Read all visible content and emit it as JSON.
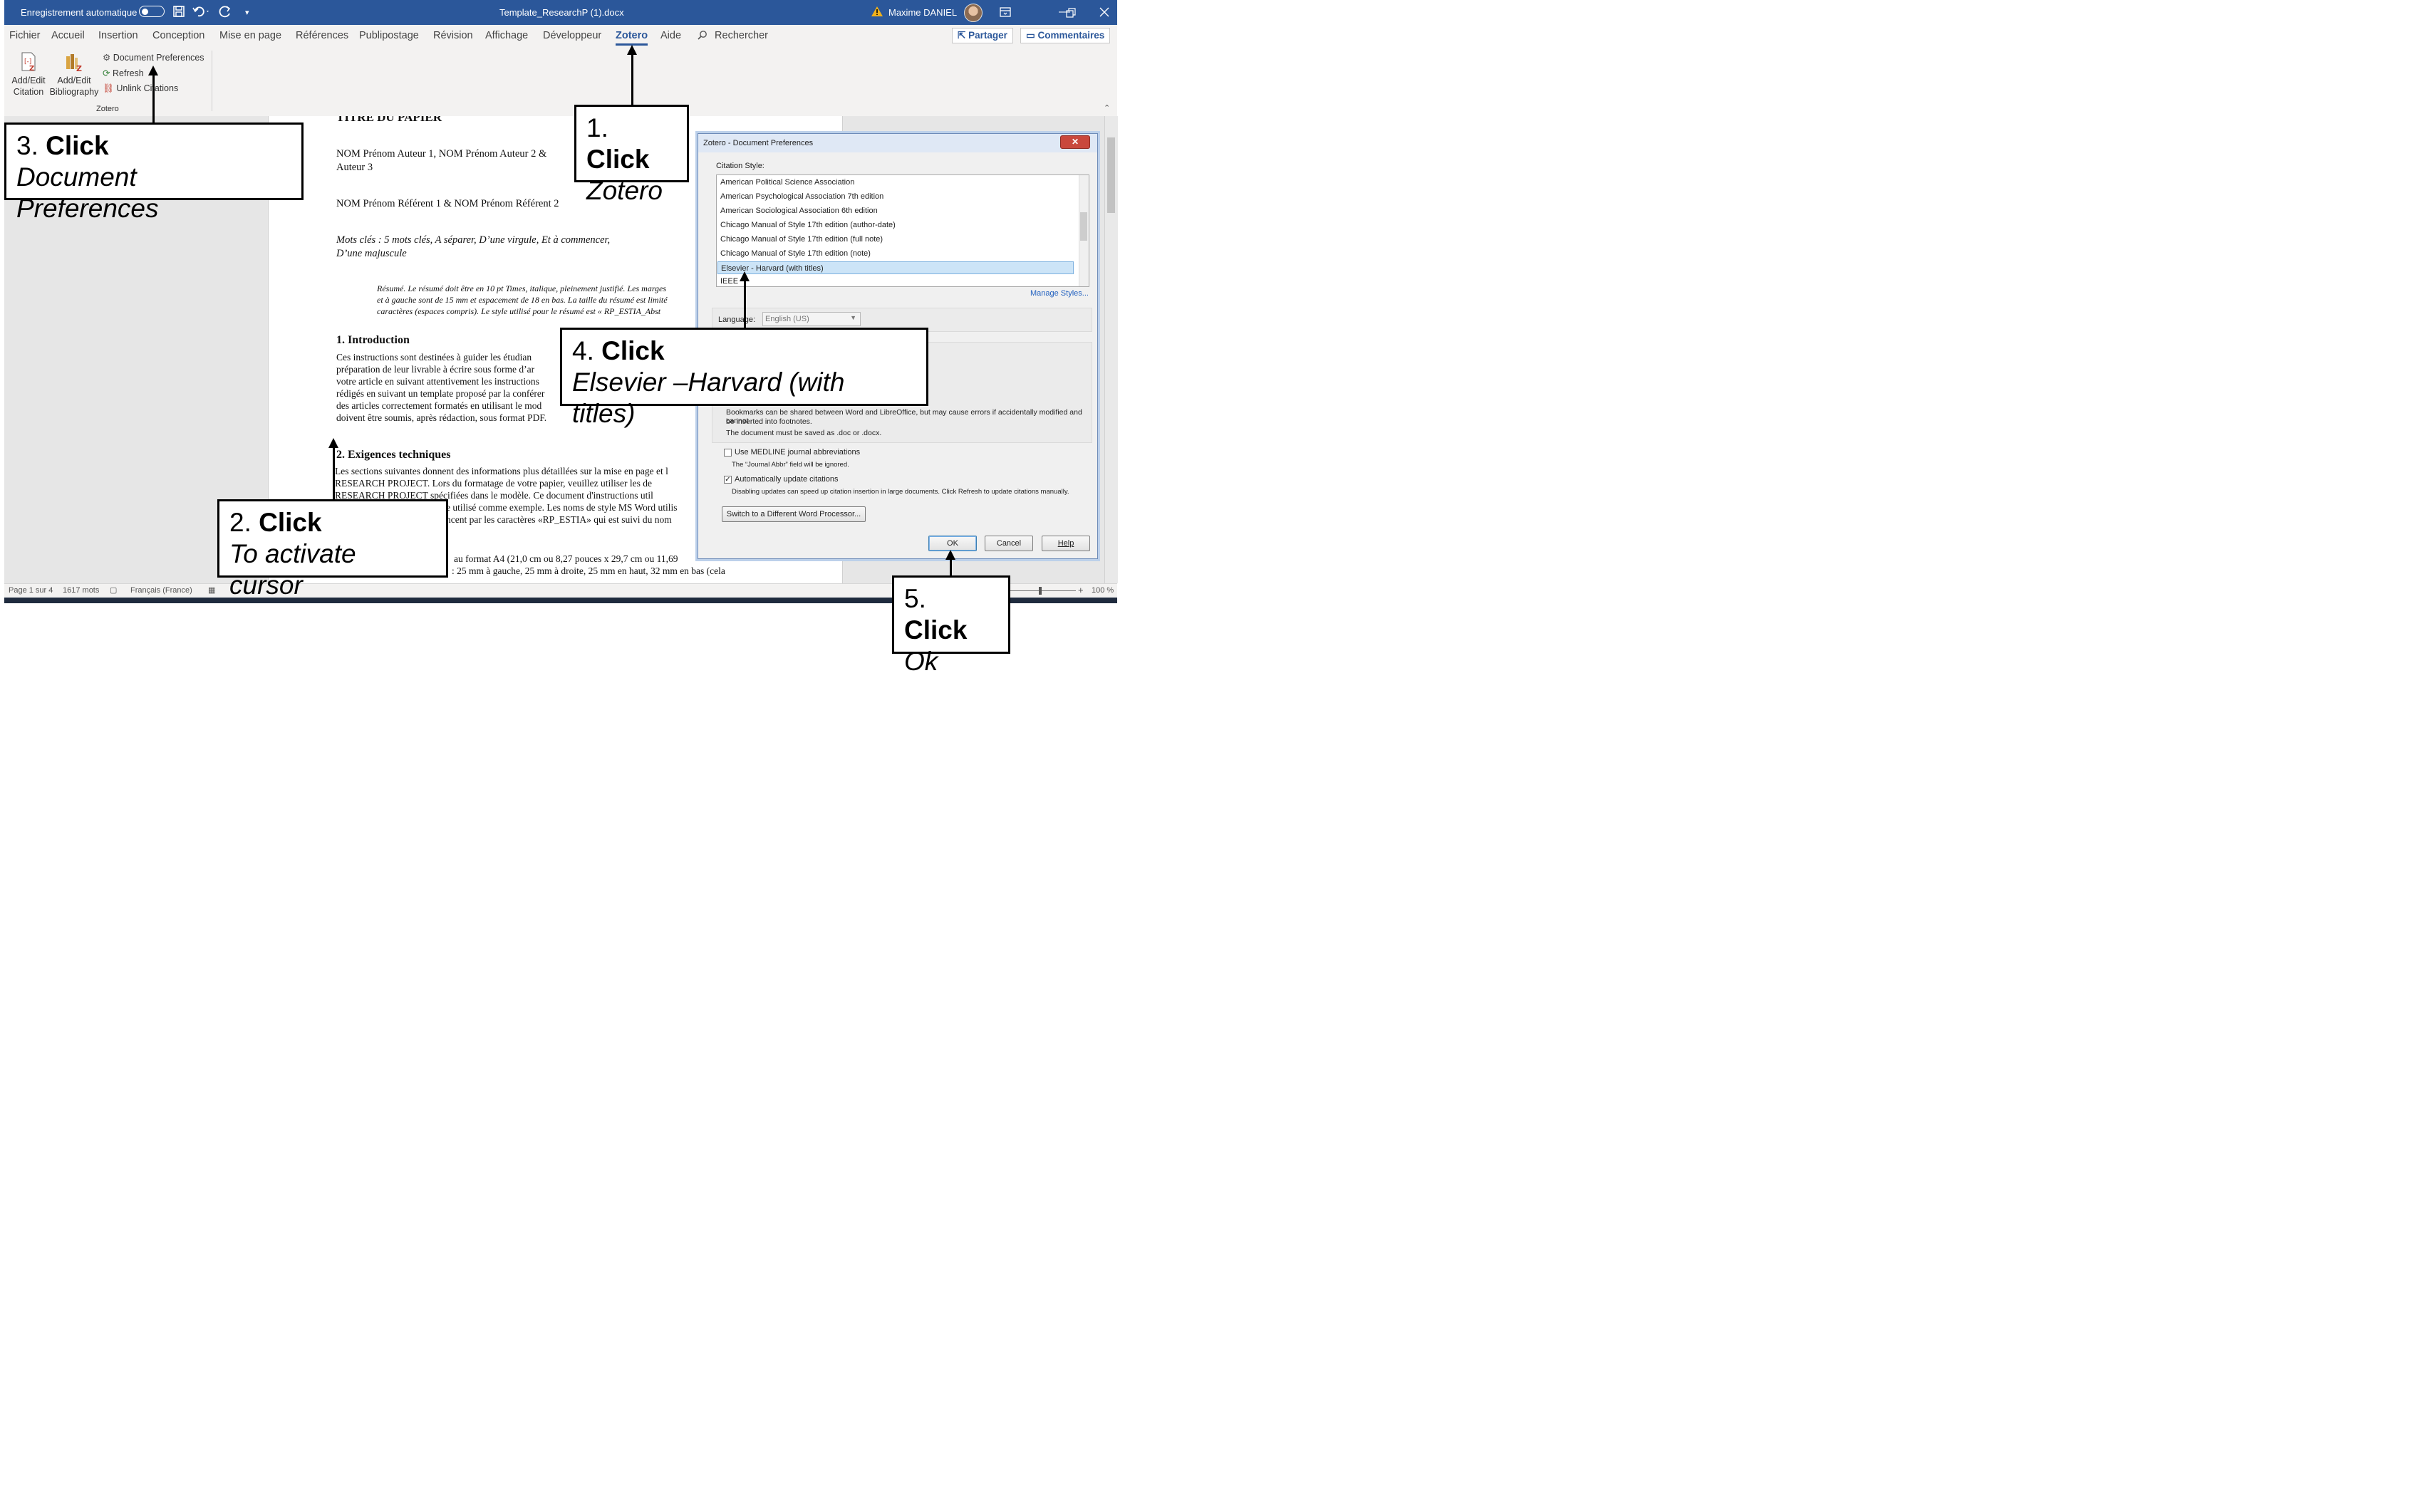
{
  "titlebar": {
    "autosave_label": "Enregistrement automatique",
    "doc_title": "Template_ResearchP (1).docx",
    "user_name": "Maxime DANIEL",
    "icons": [
      "save-icon",
      "undo-icon",
      "redo-icon",
      "customize-icon",
      "warning-icon",
      "ribbon-display-icon",
      "restore-icon",
      "close-icon"
    ]
  },
  "menu": {
    "tabs": [
      "Fichier",
      "Accueil",
      "Insertion",
      "Conception",
      "Mise en page",
      "Références",
      "Publipostage",
      "Révision",
      "Affichage",
      "Développeur",
      "Zotero",
      "Aide"
    ],
    "active_tab": "Zotero",
    "search_label": "Rechercher",
    "share_label": "Partager",
    "comments_label": "Commentaires"
  },
  "ribbon": {
    "add_edit_citation": [
      "Add/Edit",
      "Citation"
    ],
    "add_edit_bibliography": [
      "Add/Edit",
      "Bibliography"
    ],
    "document_preferences": "Document Preferences",
    "refresh": "Refresh",
    "unlink_citations": "Unlink Citations",
    "group_label": "Zotero"
  },
  "document": {
    "title": "TITRE DU PAPIER",
    "authors_1": "NOM Prénom Auteur 1, NOM Prénom Auteur 2 &",
    "authors_2": "Auteur 3",
    "referents": "NOM Prénom Référent 1 & NOM Prénom Référent 2",
    "keywords_1": "Mots clés : 5 mots clés, A séparer, D’une virgule, Et à commencer,",
    "keywords_2": "D’une majuscule",
    "abstract_1": "Résumé. Le résumé doit être en 10 pt Times, italique, pleinement justifié. Les marges",
    "abstract_2": "et à gauche sont de 15 mm et espacement de 18 en bas. La taille du résumé est limité",
    "abstract_3": "caractères (espaces compris). Le style utilisé pour le résumé est « RP_ESTIA_Abst",
    "h1": "1. Introduction",
    "intro": [
      "Ces instructions sont destinées à guider les étudian",
      "préparation de leur livrable à écrire sous forme d’ar",
      "votre article en suivant attentivement les instructions",
      "rédigés en suivant un template proposé par la conférer",
      "des articles correctement formatés en utilisant le mod",
      "doivent être soumis, après rédaction, sous format PDF."
    ],
    "h2": "2. Exigences techniques",
    "tech": [
      "Les sections suivantes donnent des informations plus détaillées sur la mise en page et l",
      "RESEARCH PROJECT. Lors du formatage de votre papier, veuillez utiliser les de",
      "RESEARCH PROJECT spécifiées dans le modèle. Ce document d'instructions util",
      "e utilisé comme exemple. Les noms de style MS Word utilis",
      "ncent par les caractères «RP_ESTIA» qui est suivi du nom"
    ],
    "page_format_1": "au format A4 (21,0 cm ou 8,27 pouces x 29,7 cm ou 11,69",
    "page_format_2": ": 25 mm à gauche, 25 mm à droite, 25 mm en haut, 32 mm en bas (cela"
  },
  "statusbar": {
    "page": "Page 1 sur 4",
    "words": "1617 mots",
    "language": "Français (France)",
    "zoom": "100 %"
  },
  "dialog": {
    "title": "Zotero - Document Preferences",
    "citation_style_label": "Citation Style:",
    "styles": [
      "American Political Science Association",
      "American Psychological Association 7th edition",
      "American Sociological Association 6th edition",
      "Chicago Manual of Style 17th edition (author-date)",
      "Chicago Manual of Style 17th edition (full note)",
      "Chicago Manual of Style 17th edition (note)",
      "Elsevier - Harvard (with titles)",
      "IEEE"
    ],
    "selected_style": "Elsevier - Harvard (with titles)",
    "manage_styles": "Manage Styles...",
    "language_label": "Language:",
    "language_value": "English (US)",
    "bookmarks_note_1": "Bookmarks can be shared between Word and LibreOffice, but may cause errors if accidentally modified and cannot",
    "bookmarks_note_2": "be inserted into footnotes.",
    "save_note": "The document must be saved as .doc or .docx.",
    "medline_label": "Use MEDLINE journal abbreviations",
    "medline_note": "The “Journal Abbr” field will be ignored.",
    "auto_update_label": "Automatically update citations",
    "auto_update_checked": true,
    "auto_update_note": "Disabling updates can speed up citation insertion in large documents. Click Refresh to update citations manually.",
    "switch_button": "Switch to a Different Word Processor...",
    "ok": "OK",
    "cancel": "Cancel",
    "help": "Help"
  },
  "callouts": {
    "c1_num": "1.",
    "c1_action": "Click",
    "c1_target": "Zotero",
    "c2_num": "2.",
    "c2_action": "Click",
    "c2_target_1": "To activate",
    "c2_target_2": "cursor",
    "c3_num": "3.",
    "c3_action": "Click",
    "c3_target_1": "Document",
    "c3_target_2": "Preferences",
    "c4_num": "4.",
    "c4_action": "Click",
    "c4_target_1": "Elsevier –Harvard (with",
    "c4_target_2": "titles)",
    "c5_num": "5.",
    "c5_action": "Click",
    "c5_target": "Ok"
  }
}
